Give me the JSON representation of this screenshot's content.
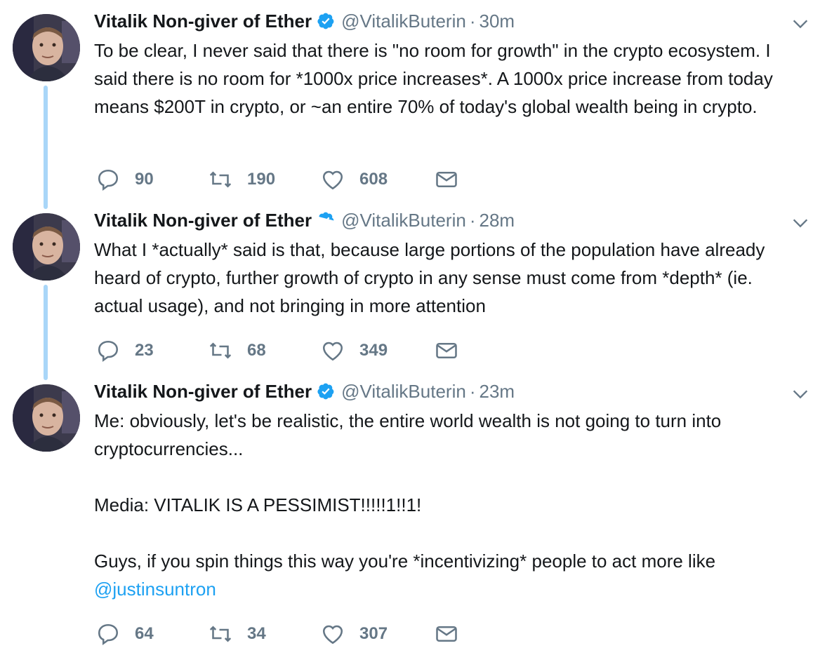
{
  "tweets": [
    {
      "name": "Vitalik Non-giver of Ether",
      "handle": "@VitalikButerin",
      "separator": "·",
      "time": "30m",
      "text": "To be clear, I never said that there is \"no room for growth\" in the crypto ecosystem. I said there is no room for *1000x price increases*. A 1000x price increase from today means $200T in crypto, or ~an entire 70% of today's global wealth being in crypto.",
      "replies": "90",
      "retweets": "190",
      "likes": "608"
    },
    {
      "name": "Vitalik Non-giver of Ether",
      "handle": "@VitalikButerin",
      "separator": "·",
      "time": "28m",
      "text": "What I *actually* said is that, because large portions of the population have already heard of crypto, further growth of crypto in any sense must come from *depth* (ie. actual usage), and not bringing in more attention",
      "replies": "23",
      "retweets": "68",
      "likes": "349"
    },
    {
      "name": "Vitalik Non-giver of Ether",
      "handle": "@VitalikButerin",
      "separator": "·",
      "time": "23m",
      "text_line1": "Me: obviously, let's be realistic, the entire world wealth is not going to turn into cryptocurrencies...",
      "text_line2": "Media: VITALIK IS A PESSIMIST!!!!!1!!1!",
      "text_line3": "Guys, if you spin things this way you're *incentivizing* people to act more like ",
      "mention": "@justinsuntron",
      "replies": "64",
      "retweets": "34",
      "likes": "307"
    }
  ],
  "icons": {
    "reply": "reply-icon",
    "retweet": "retweet-icon",
    "like": "heart-icon",
    "dm": "envelope-icon",
    "verified": "verified-badge-icon",
    "caret": "chevron-down-icon"
  },
  "colors": {
    "accent": "#1da1f2",
    "thread_line": "#a9d6f8",
    "muted": "#657786",
    "text": "#14171a"
  }
}
